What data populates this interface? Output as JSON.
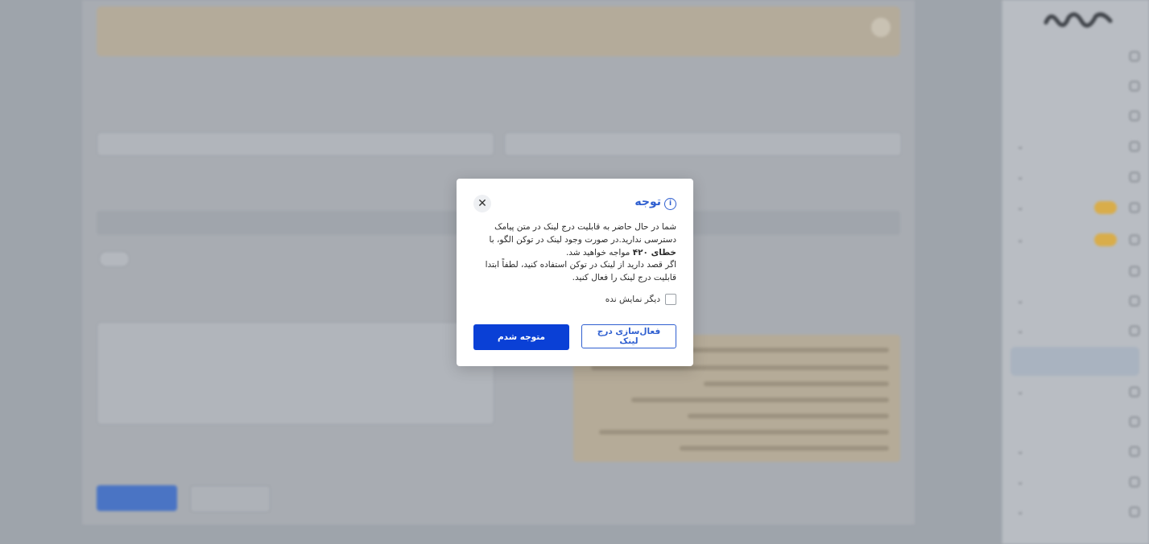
{
  "modal": {
    "title": "توجه",
    "line1": "شما در حال حاضر به قابلیت درج لینک در متن پیامک دسترسی ندارید.در صورت وجود لینک در توکن الگو، با",
    "error_bold": "خطای ۴۲۰",
    "line2": " مواجه خواهید شد.",
    "line3": "اگر قصد دارید از لینک در توکن استفاده کنید، لطفاً ابتدا قابلیت درج لینک را فعال کنید.",
    "dont_show_label": "دیگر نمایش نده",
    "enable_link_label": "فعال‌سازی درج لینک",
    "ok_label": "متوجه شدم",
    "close_symbol": "✕",
    "info_symbol": "i"
  },
  "colors": {
    "primary": "#0a40d6",
    "accent_text": "#2f5fd0",
    "overlay": "#9ea4ab"
  }
}
